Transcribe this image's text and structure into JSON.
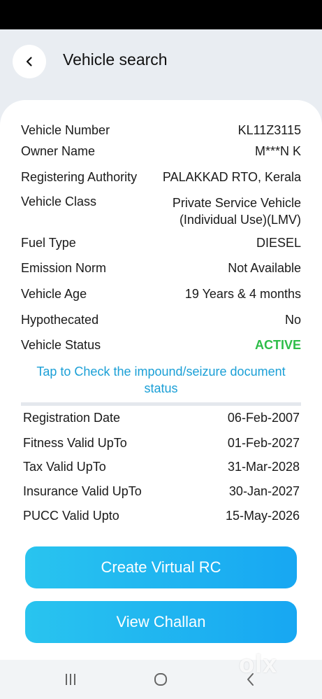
{
  "header": {
    "title": "Vehicle search"
  },
  "vehicle": {
    "rows": [
      {
        "label": "Vehicle Number",
        "value": "KL11Z3115"
      },
      {
        "label": "Owner Name",
        "value": "M***N K"
      },
      {
        "label": "Registering Authority",
        "value": "PALAKKAD RTO, Kerala"
      },
      {
        "label": "Vehicle Class",
        "value": "Private Service Vehicle (Individual Use)(LMV)"
      },
      {
        "label": "Fuel Type",
        "value": "DIESEL"
      },
      {
        "label": "Emission Norm",
        "value": "Not Available"
      },
      {
        "label": "Vehicle Age",
        "value": "19 Years  & 4 months"
      },
      {
        "label": "Hypothecated",
        "value": "No"
      },
      {
        "label": "Vehicle Status",
        "value": "ACTIVE"
      }
    ],
    "impound_link": "Tap to Check the impound/seizure document status"
  },
  "validity": {
    "rows": [
      {
        "label": "Registration Date",
        "value": "06-Feb-2007"
      },
      {
        "label": "Fitness Valid UpTo",
        "value": "01-Feb-2027"
      },
      {
        "label": "Tax Valid UpTo",
        "value": "31-Mar-2028"
      },
      {
        "label": "Insurance Valid UpTo",
        "value": "30-Jan-2027"
      },
      {
        "label": "PUCC Valid Upto",
        "value": "15-May-2026"
      }
    ]
  },
  "buttons": {
    "create_virtual_rc": "Create Virtual RC",
    "view_challan": "View Challan"
  },
  "colors": {
    "accent": "#1a9fd6",
    "active_status": "#2dbd48",
    "button_gradient_start": "#29c4ef",
    "button_gradient_end": "#17a7f2"
  },
  "nav": {
    "icons": [
      "recent-apps-icon",
      "home-icon",
      "back-icon"
    ]
  },
  "watermark": {
    "text": "olx"
  }
}
